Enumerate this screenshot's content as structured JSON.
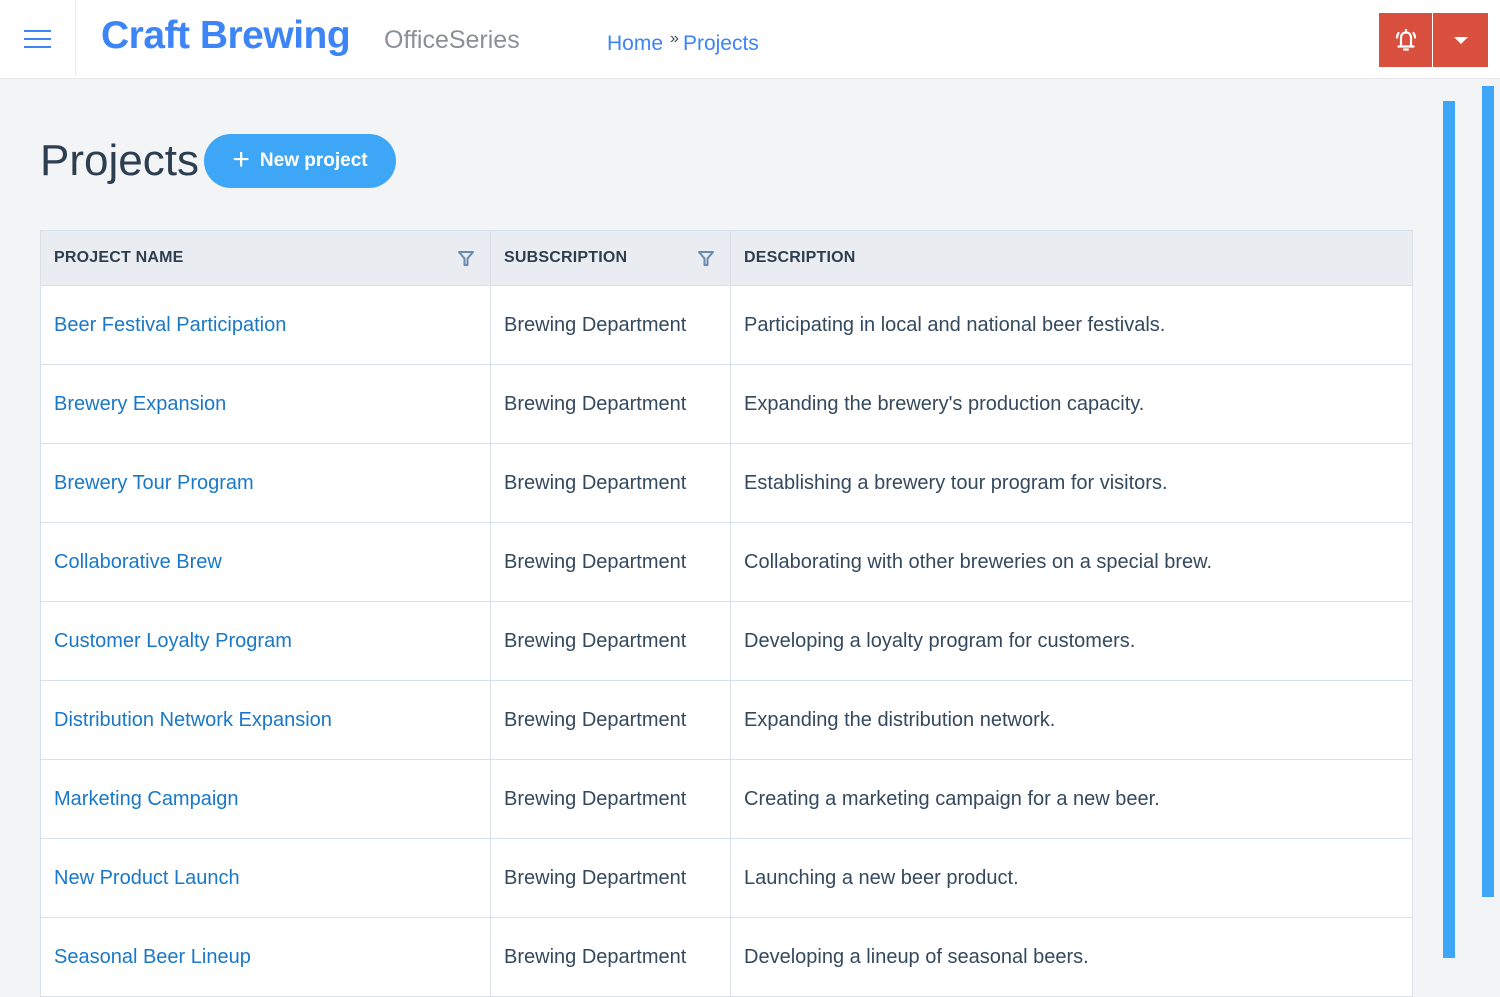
{
  "header": {
    "brand": "Craft Brewing",
    "suite": "OfficeSeries",
    "menu_icon": "hamburger-icon",
    "breadcrumb": [
      {
        "label": "Home"
      },
      {
        "label": "Projects"
      }
    ],
    "breadcrumb_separator": "»",
    "alerts_icon": "alarm-bell-icon",
    "dropdown_icon": "caret-down-icon",
    "accent_color": "#d9503f"
  },
  "page": {
    "title": "Projects",
    "new_button": {
      "icon": "plus-icon",
      "icon_glyph": "+",
      "label": "New project"
    }
  },
  "table": {
    "columns": [
      {
        "label": "PROJECT NAME",
        "filterable": true
      },
      {
        "label": "SUBSCRIPTION",
        "filterable": true
      },
      {
        "label": "DESCRIPTION",
        "filterable": false
      }
    ],
    "rows": [
      {
        "name": "Beer Festival Participation",
        "subscription": "Brewing Department",
        "description": "Participating in local and national beer festivals."
      },
      {
        "name": "Brewery Expansion",
        "subscription": "Brewing Department",
        "description": "Expanding the brewery's production capacity."
      },
      {
        "name": "Brewery Tour Program",
        "subscription": "Brewing Department",
        "description": "Establishing a brewery tour program for visitors."
      },
      {
        "name": "Collaborative Brew",
        "subscription": "Brewing Department",
        "description": "Collaborating with other breweries on a special brew."
      },
      {
        "name": "Customer Loyalty Program",
        "subscription": "Brewing Department",
        "description": "Developing a loyalty program for customers."
      },
      {
        "name": "Distribution Network Expansion",
        "subscription": "Brewing Department",
        "description": "Expanding the distribution network."
      },
      {
        "name": "Marketing Campaign",
        "subscription": "Brewing Department",
        "description": "Creating a marketing campaign for a new beer."
      },
      {
        "name": "New Product Launch",
        "subscription": "Brewing Department",
        "description": "Launching a new beer product."
      },
      {
        "name": "Seasonal Beer Lineup",
        "subscription": "Brewing Department",
        "description": "Developing a lineup of seasonal beers."
      }
    ]
  },
  "colors": {
    "brand": "#3d84f7",
    "link": "#1978c8",
    "primary_button": "#3ea6f7",
    "scrollbar": "#3ea6f7"
  }
}
